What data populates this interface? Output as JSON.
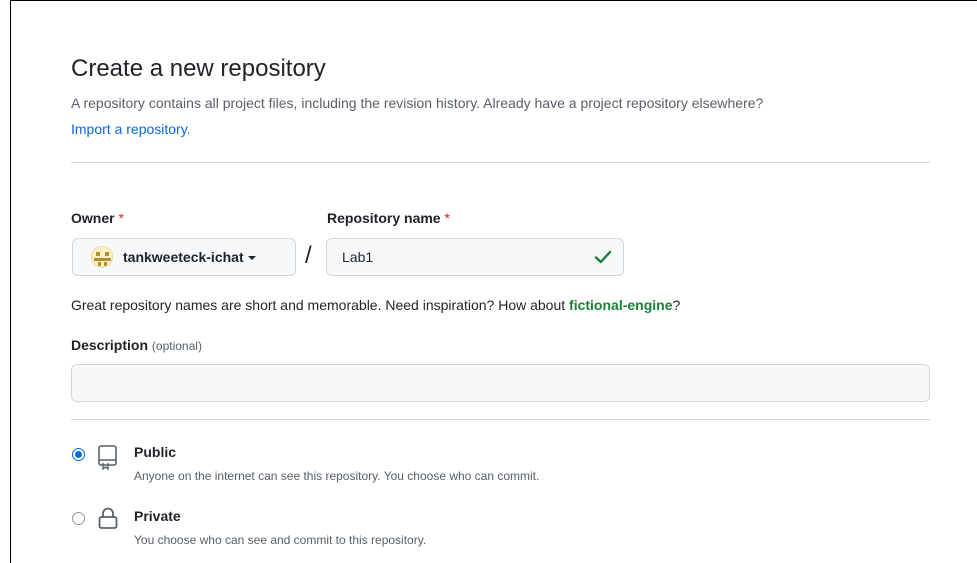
{
  "page": {
    "title": "Create a new repository",
    "subtitle": "A repository contains all project files, including the revision history. Already have a project repository elsewhere?",
    "import_link": "Import a repository."
  },
  "owner": {
    "label": "Owner",
    "required_mark": "*",
    "value": "tankweeteck-ichat",
    "avatar_icon": "identicon-avatar",
    "dropdown_icon": "caret-down-icon"
  },
  "separator": "/",
  "repository": {
    "label": "Repository name",
    "required_mark": "*",
    "value": "Lab1",
    "valid_icon": "check-icon"
  },
  "hint": {
    "text": "Great repository names are short and memorable. Need inspiration? How about ",
    "suggestion": "fictional-engine",
    "suffix": "?"
  },
  "description": {
    "label": "Description",
    "optional": "(optional)",
    "value": ""
  },
  "visibility": {
    "options": [
      {
        "title": "Public",
        "desc": "Anyone on the internet can see this repository. You choose who can commit.",
        "selected": true,
        "icon": "repo-icon"
      },
      {
        "title": "Private",
        "desc": "You choose who can see and commit to this repository.",
        "selected": false,
        "icon": "lock-icon"
      }
    ]
  },
  "colors": {
    "link": "#0969da",
    "success": "#1a7f37",
    "required": "#cf222e",
    "border": "#d0d7de",
    "input_bg": "#f6f8fa"
  }
}
